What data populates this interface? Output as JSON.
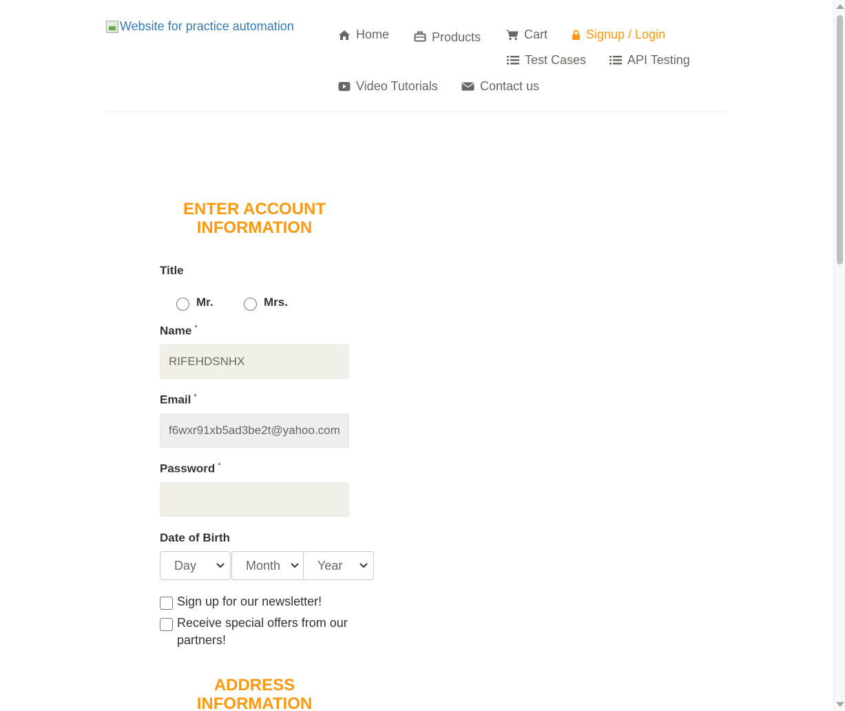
{
  "header": {
    "logo_alt": "Website for practice automation",
    "nav": {
      "home": "Home",
      "products": "Products",
      "cart": "Cart",
      "signup_login": "Signup / Login",
      "test_cases": "Test Cases",
      "api_testing": "API Testing",
      "video_tutorials": "Video Tutorials",
      "contact_us": "Contact us"
    }
  },
  "form": {
    "title_line1": "ENTER ACCOUNT",
    "title_line2": "INFORMATION",
    "title_label": "Title",
    "title_options": [
      "Mr.",
      "Mrs."
    ],
    "name_label": "Name",
    "name_value": "RIFEHDSNHX",
    "email_label": "Email",
    "email_value": "f6wxr91xb5ad3be2t@yahoo.com",
    "password_label": "Password",
    "password_value": "",
    "required_mark": "*",
    "dob_label": "Date of Birth",
    "dob_day": "Day",
    "dob_month": "Month",
    "dob_year": "Year",
    "newsletter_label": "Sign up for our newsletter!",
    "offers_label": "Receive special offers from our partners!"
  },
  "address": {
    "title_line1": "ADDRESS",
    "title_line2": "INFORMATION"
  },
  "colors": {
    "accent": "#fe980f",
    "nav_text": "#696763",
    "link": "#337ab7"
  }
}
